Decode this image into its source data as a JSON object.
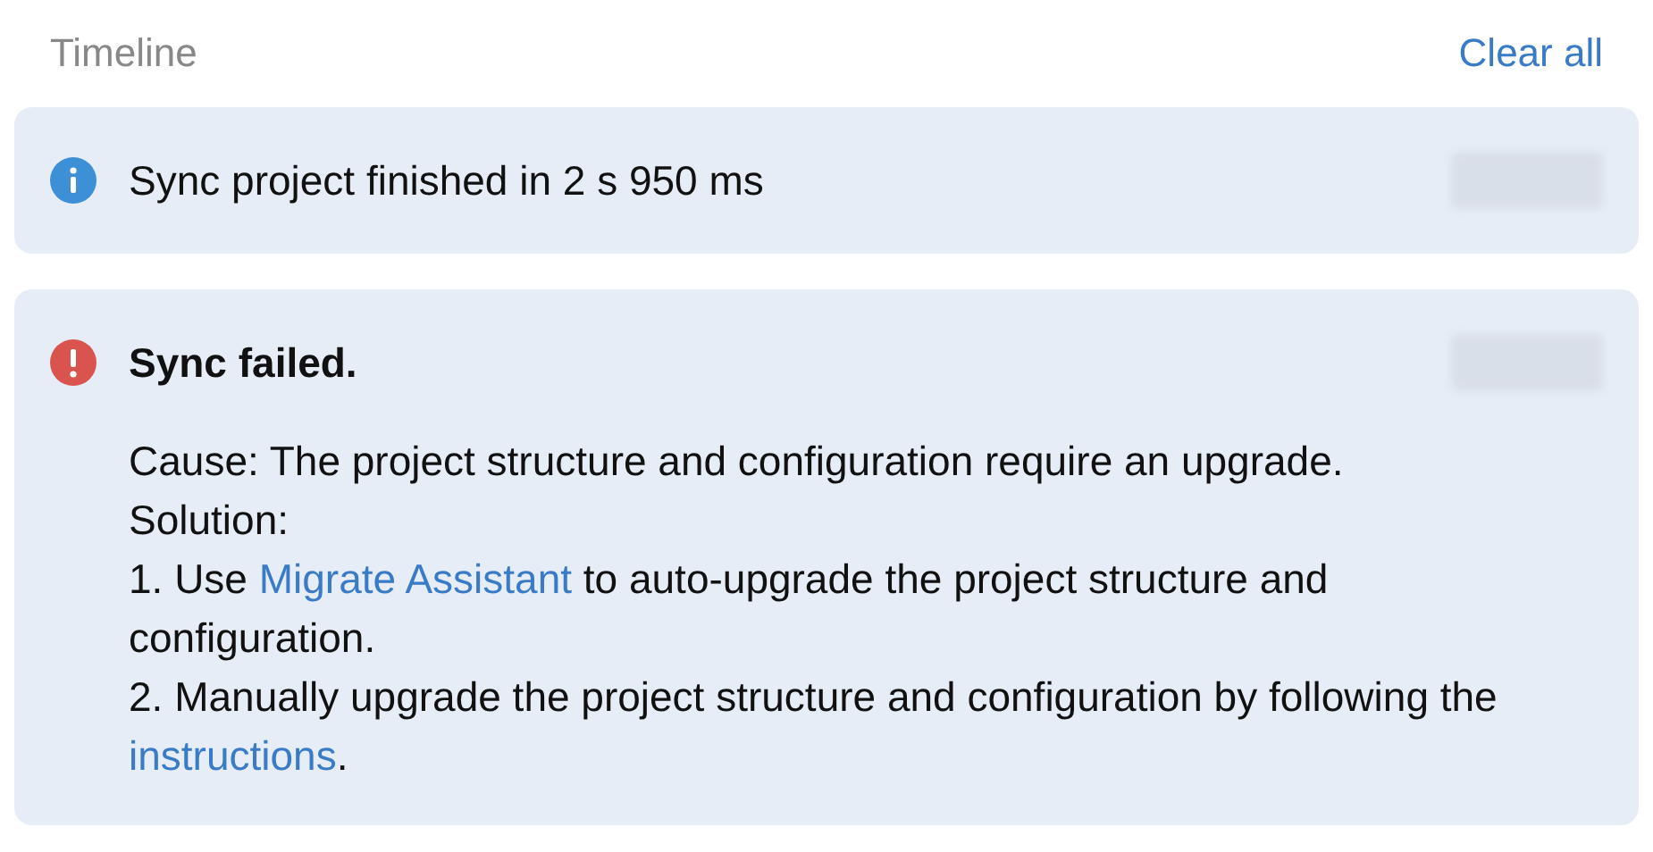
{
  "header": {
    "title": "Timeline",
    "action": "Clear all"
  },
  "events": [
    {
      "kind": "info",
      "title": "Sync project finished in 2 s 950 ms",
      "bold": false
    },
    {
      "kind": "error",
      "title": "Sync failed.",
      "bold": true,
      "paragraphs": [
        [
          {
            "text": "Cause: The project structure and configuration require an upgrade.",
            "link": false
          }
        ],
        [
          {
            "text": "Solution:",
            "link": false
          }
        ],
        [
          {
            "text": "1. Use ",
            "link": false
          },
          {
            "text": "Migrate Assistant",
            "link": true
          },
          {
            "text": " to auto-upgrade the project structure and configuration.",
            "link": false
          }
        ],
        [
          {
            "text": "2. Manually upgrade the project structure and configuration by following the ",
            "link": false
          },
          {
            "text": "instructions",
            "link": true
          },
          {
            "text": ".",
            "link": false
          }
        ]
      ]
    }
  ]
}
